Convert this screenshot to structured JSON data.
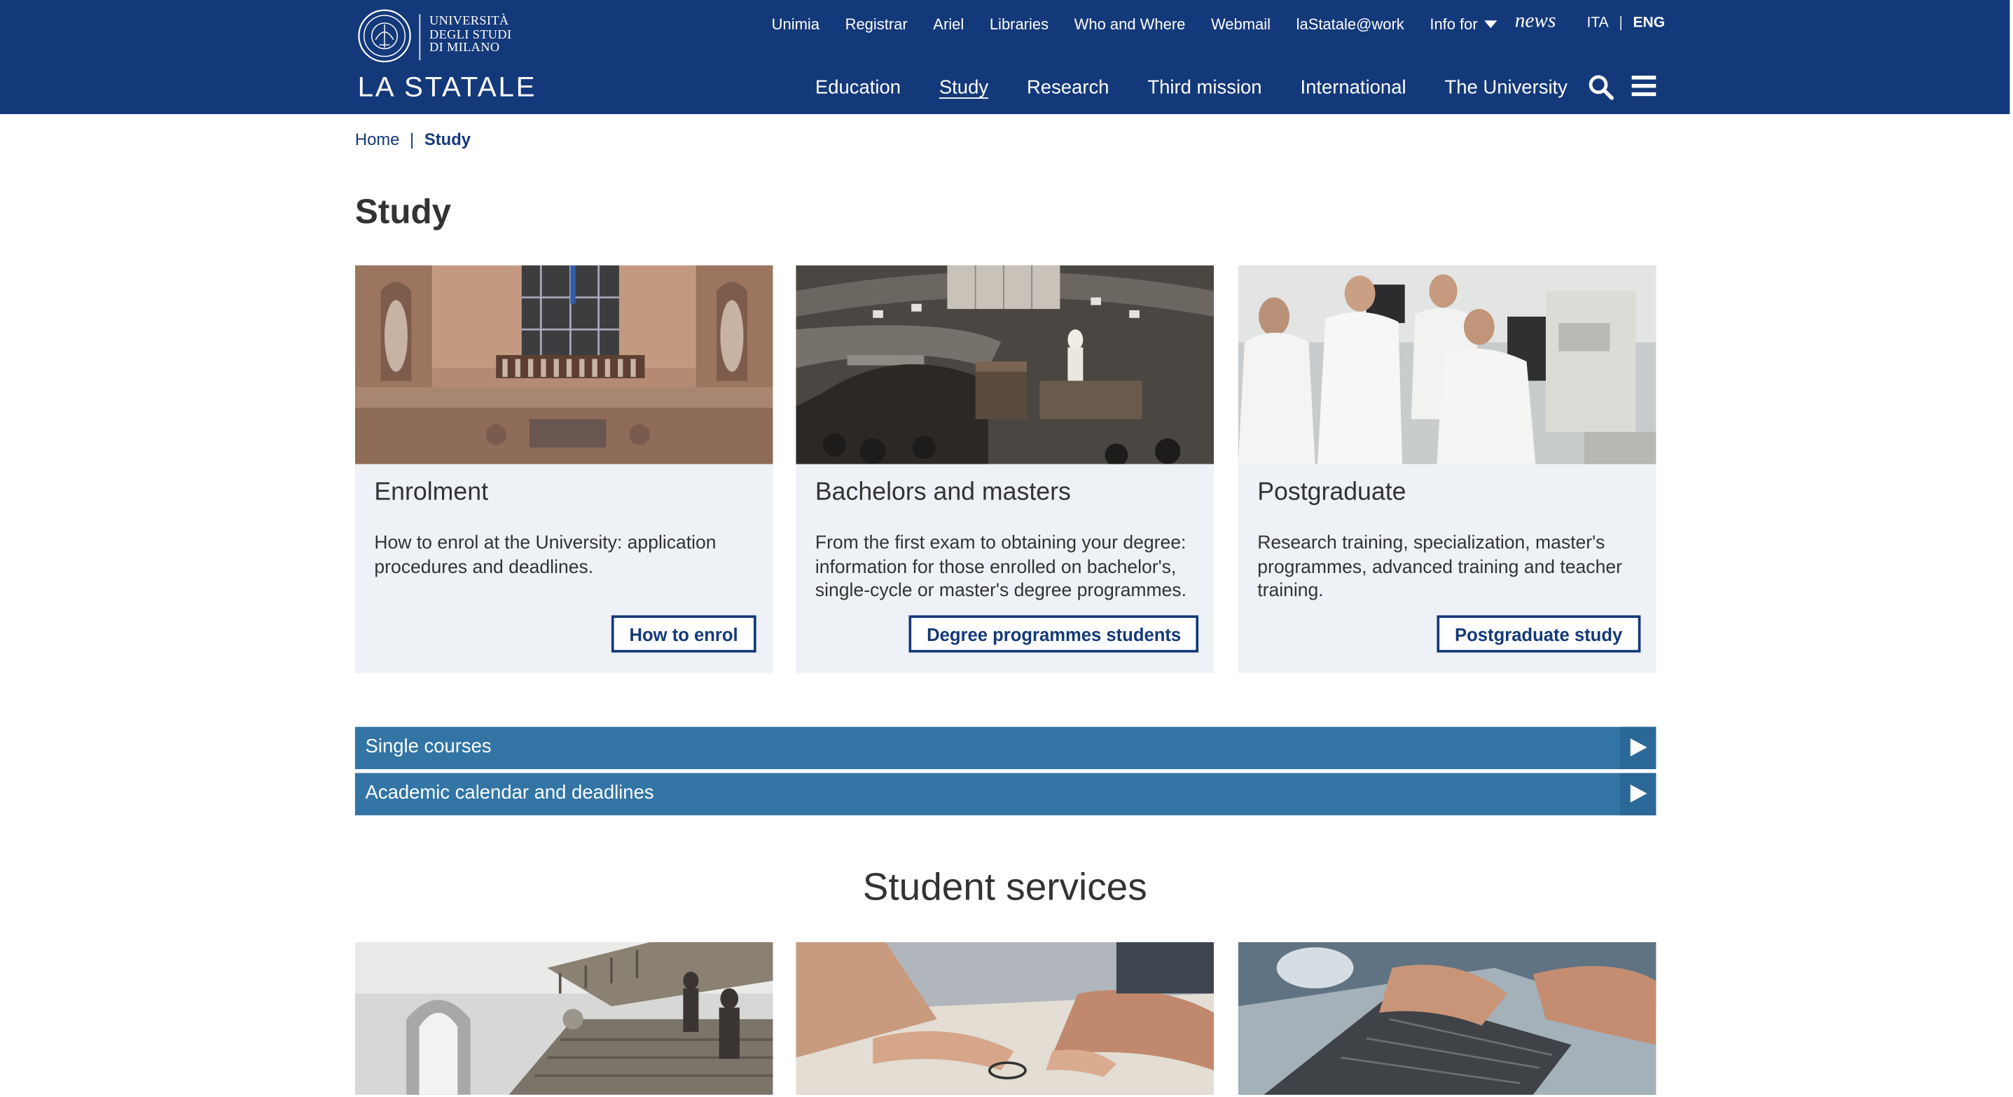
{
  "header": {
    "logo": {
      "line1": "UNIVERSITÀ",
      "line2": "DEGLI STUDI",
      "line3": "DI MILANO",
      "wordmark": "LA STATALE"
    },
    "top_links": [
      "Unimia",
      "Registrar",
      "Ariel",
      "Libraries",
      "Who and Where",
      "Webmail",
      "laStatale@work"
    ],
    "info_for": "Info for",
    "news": "news",
    "lang": {
      "ita": "ITA",
      "sep": "|",
      "eng": "ENG",
      "active": "ENG"
    },
    "main_nav": [
      "Education",
      "Study",
      "Research",
      "Third mission",
      "International",
      "The University"
    ],
    "current_nav": "Study",
    "icons": {
      "search": "search-icon",
      "menu": "hamburger-menu-icon"
    },
    "brand_color": "#14397a"
  },
  "breadcrumb": {
    "home": "Home",
    "sep": "|",
    "current": "Study"
  },
  "page_title": "Study",
  "cards": [
    {
      "title": "Enrolment",
      "text": "How to enrol at the University: application procedures and deadlines.",
      "button": "How to enrol",
      "image": "university-facade-photo"
    },
    {
      "title": "Bachelors and masters",
      "text": "From the first exam to obtaining your degree: information for those enrolled on bachelor's, single-cycle or master's degree programmes.",
      "button": "Degree programmes students",
      "image": "lecture-hall-photo"
    },
    {
      "title": "Postgraduate",
      "text": "Research training, specialization, master's programmes, advanced training and teacher training.",
      "button": "Postgraduate study",
      "image": "lab-researchers-photo"
    }
  ],
  "accordions": [
    {
      "label": "Single courses",
      "icon": "play-arrow-icon"
    },
    {
      "label": "Academic calendar and deadlines",
      "icon": "play-arrow-icon"
    }
  ],
  "services": {
    "title": "Student services",
    "images": [
      "stairway-photo",
      "study-desk-photo",
      "laptop-photo"
    ]
  },
  "colors": {
    "header_bg": "#14397a",
    "accordion_bg": "#3275a5",
    "card_bg": "#eef1f5"
  }
}
